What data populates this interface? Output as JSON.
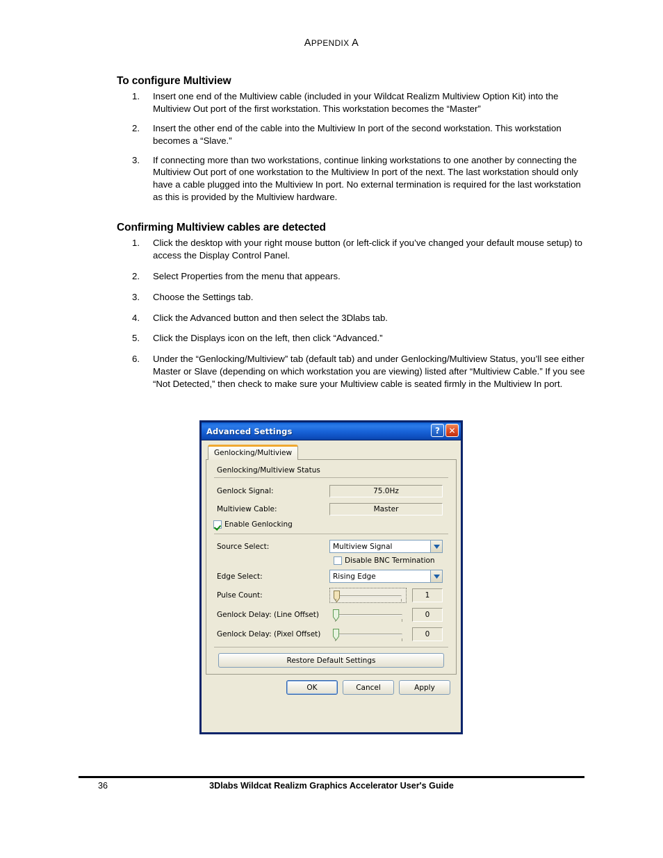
{
  "page": {
    "running_head_first": "A",
    "running_head_rest": "PPENDIX",
    "running_head_tail": "A",
    "footer_page_number": "36",
    "footer_title": "3Dlabs Wildcat Realizm Graphics Accelerator User's Guide"
  },
  "sections": [
    {
      "heading": "To configure Multiview",
      "steps": [
        {
          "num": "1.",
          "text": "Insert one end of the Multiview cable (included in your Wildcat Realizm Multiview Option Kit) into the Multiview Out port of the first workstation. This workstation becomes the “Master”"
        },
        {
          "num": "2.",
          "text": "Insert the other end of the cable into the Multiview In port of the second workstation. This workstation becomes a “Slave.”"
        },
        {
          "num": "3.",
          "text": "If connecting more than two workstations, continue linking workstations to one another by connecting the Multiview Out port of one workstation to the Multiview In port of the next. The last workstation should only have a cable plugged into the Multiview In port. No external termination is required for the last workstation as this is provided by the Multiview hardware."
        }
      ]
    },
    {
      "heading": "Confirming Multiview cables are detected",
      "steps": [
        {
          "num": "1.",
          "text": "Click the desktop with your right mouse button (or left-click if you’ve changed your default mouse setup) to access the Display Control Panel."
        },
        {
          "num": "2.",
          "text": "Select Properties from the menu that appears."
        },
        {
          "num": "3.",
          "text": "Choose the Settings tab."
        },
        {
          "num": "4.",
          "text": "Click the Advanced button and then select the 3Dlabs tab."
        },
        {
          "num": "5.",
          "text": "Click the Displays icon on the left, then click “Advanced.”"
        },
        {
          "num": "6.",
          "text": "Under the “Genlocking/Multiview” tab (default tab) and under Genlocking/Multiview Status, you’ll see either Master or Slave (depending on which workstation you are viewing) listed after “Multiview Cable.” If you see “Not Detected,” then check to make sure your Multiview cable is seated firmly in the Multiview In port."
        }
      ]
    }
  ],
  "dialog": {
    "title": "Advanced Settings",
    "help_button": "?",
    "close_button": "✕",
    "tab": "Genlocking/Multiview",
    "group_title": "Genlocking/Multiview Status",
    "status_rows": [
      {
        "label": "Genlock Signal:",
        "value": "75.0Hz"
      },
      {
        "label": "Multiview Cable:",
        "value": "Master"
      }
    ],
    "enable_genlocking": {
      "label": "Enable Genlocking",
      "checked": true
    },
    "source_select": {
      "label": "Source Select:",
      "value": "Multiview Signal"
    },
    "disable_bnc": {
      "label": "Disable BNC Termination",
      "checked": false
    },
    "edge_select": {
      "label": "Edge Select:",
      "value": "Rising Edge"
    },
    "sliders": [
      {
        "label": "Pulse Count:",
        "value": "1"
      },
      {
        "label": "Genlock Delay: (Line Offset)",
        "value": "0"
      },
      {
        "label": "Genlock Delay: (Pixel Offset)",
        "value": "0"
      }
    ],
    "restore_button": "Restore Default Settings",
    "ok_button": "OK",
    "cancel_button": "Cancel",
    "apply_button": "Apply"
  },
  "colors": {
    "titlebar_blue": "#1863d8",
    "dialog_face": "#ece9d8",
    "tab_accent_orange": "#f0a830",
    "close_red": "#e0522a",
    "check_green": "#0d8a0d"
  }
}
